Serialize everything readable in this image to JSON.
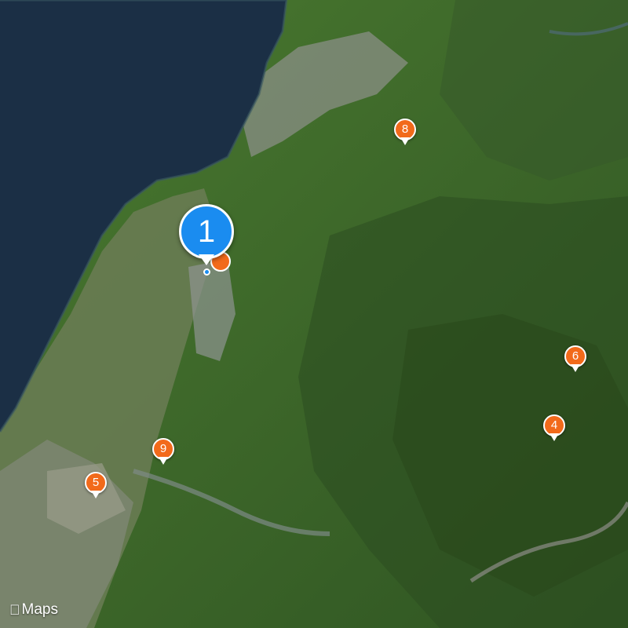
{
  "map": {
    "style": "satellite",
    "colors": {
      "sea": "#1b2f45",
      "forest": "#3f6a2a",
      "plain": "#6f7f5a",
      "urban": "#8c9390",
      "pin": "#f26a1b",
      "selected_pin": "#1a8cf0"
    }
  },
  "selected_marker": {
    "label": "1"
  },
  "markers": [
    {
      "label": "4"
    },
    {
      "label": "5"
    },
    {
      "label": "6"
    },
    {
      "label": "8"
    },
    {
      "label": "9"
    }
  ],
  "attribution": {
    "icon": "apple-logo-icon",
    "text": "Maps"
  }
}
